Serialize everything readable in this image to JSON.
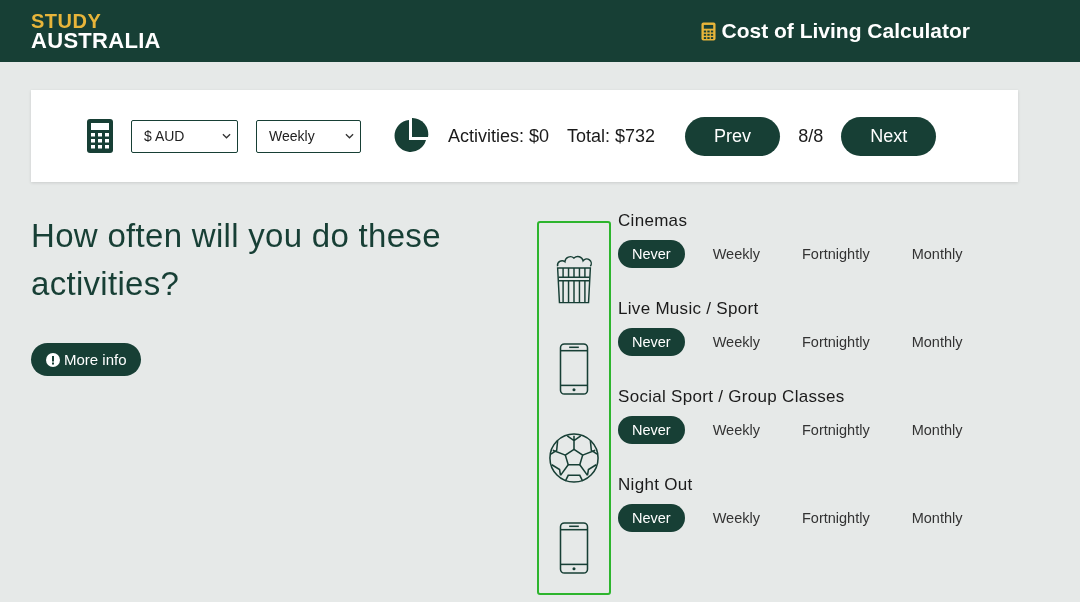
{
  "header": {
    "logo_top": "STUDY",
    "logo_bottom": "AUSTRALIA",
    "title": "Cost of Living Calculator"
  },
  "toolbar": {
    "currency": "$ AUD",
    "period": "Weekly",
    "activities": "Activities: $0",
    "total": "Total: $732",
    "prev": "Prev",
    "page": "8/8",
    "next": "Next"
  },
  "question": {
    "title": "How often will you do these activities?",
    "more_info": "More info"
  },
  "activities": [
    {
      "name": "Cinemas",
      "options": [
        {
          "label": "Never",
          "selected": true
        },
        {
          "label": "Weekly",
          "selected": false
        },
        {
          "label": "Fortnightly",
          "selected": false
        },
        {
          "label": "Monthly",
          "selected": false
        }
      ]
    },
    {
      "name": "Live Music / Sport",
      "options": [
        {
          "label": "Never",
          "selected": true
        },
        {
          "label": "Weekly",
          "selected": false
        },
        {
          "label": "Fortnightly",
          "selected": false
        },
        {
          "label": "Monthly",
          "selected": false
        }
      ]
    },
    {
      "name": "Social Sport / Group Classes",
      "options": [
        {
          "label": "Never",
          "selected": true
        },
        {
          "label": "Weekly",
          "selected": false
        },
        {
          "label": "Fortnightly",
          "selected": false
        },
        {
          "label": "Monthly",
          "selected": false
        }
      ]
    },
    {
      "name": "Night Out",
      "options": [
        {
          "label": "Never",
          "selected": true
        },
        {
          "label": "Weekly",
          "selected": false
        },
        {
          "label": "Fortnightly",
          "selected": false
        },
        {
          "label": "Monthly",
          "selected": false
        }
      ]
    }
  ]
}
